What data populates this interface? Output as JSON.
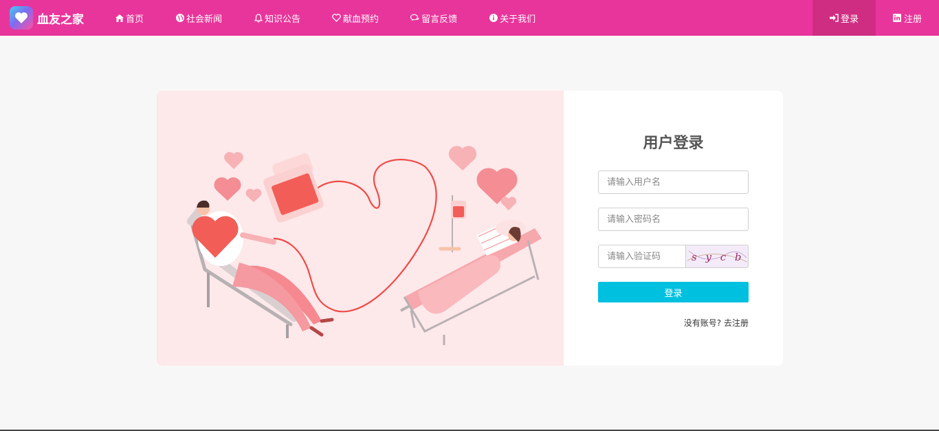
{
  "brand": {
    "name": "血友之家",
    "logo_icon": "heart-logo-icon"
  },
  "nav": {
    "items": [
      {
        "label": "首页",
        "icon": "home-icon"
      },
      {
        "label": "社会新闻",
        "icon": "globe-icon"
      },
      {
        "label": "知识公告",
        "icon": "bell-icon"
      },
      {
        "label": "献血预约",
        "icon": "heart-outline-icon"
      },
      {
        "label": "留言反馈",
        "icon": "comments-icon"
      },
      {
        "label": "关于我们",
        "icon": "info-icon"
      }
    ],
    "login_label": "登录",
    "register_label": "注册"
  },
  "login": {
    "title": "用户登录",
    "username_placeholder": "请输入用户名",
    "password_placeholder": "请输入密码名",
    "captcha_placeholder": "请输入验证码",
    "captcha_text": "s y c b",
    "submit_label": "登录",
    "no_account_text": "没有账号?",
    "register_link": "去注册"
  },
  "colors": {
    "navbar": "#e8359b",
    "nav_active": "#cf2d82",
    "illustration_bg": "#fde8ea",
    "button": "#00c0e0"
  }
}
